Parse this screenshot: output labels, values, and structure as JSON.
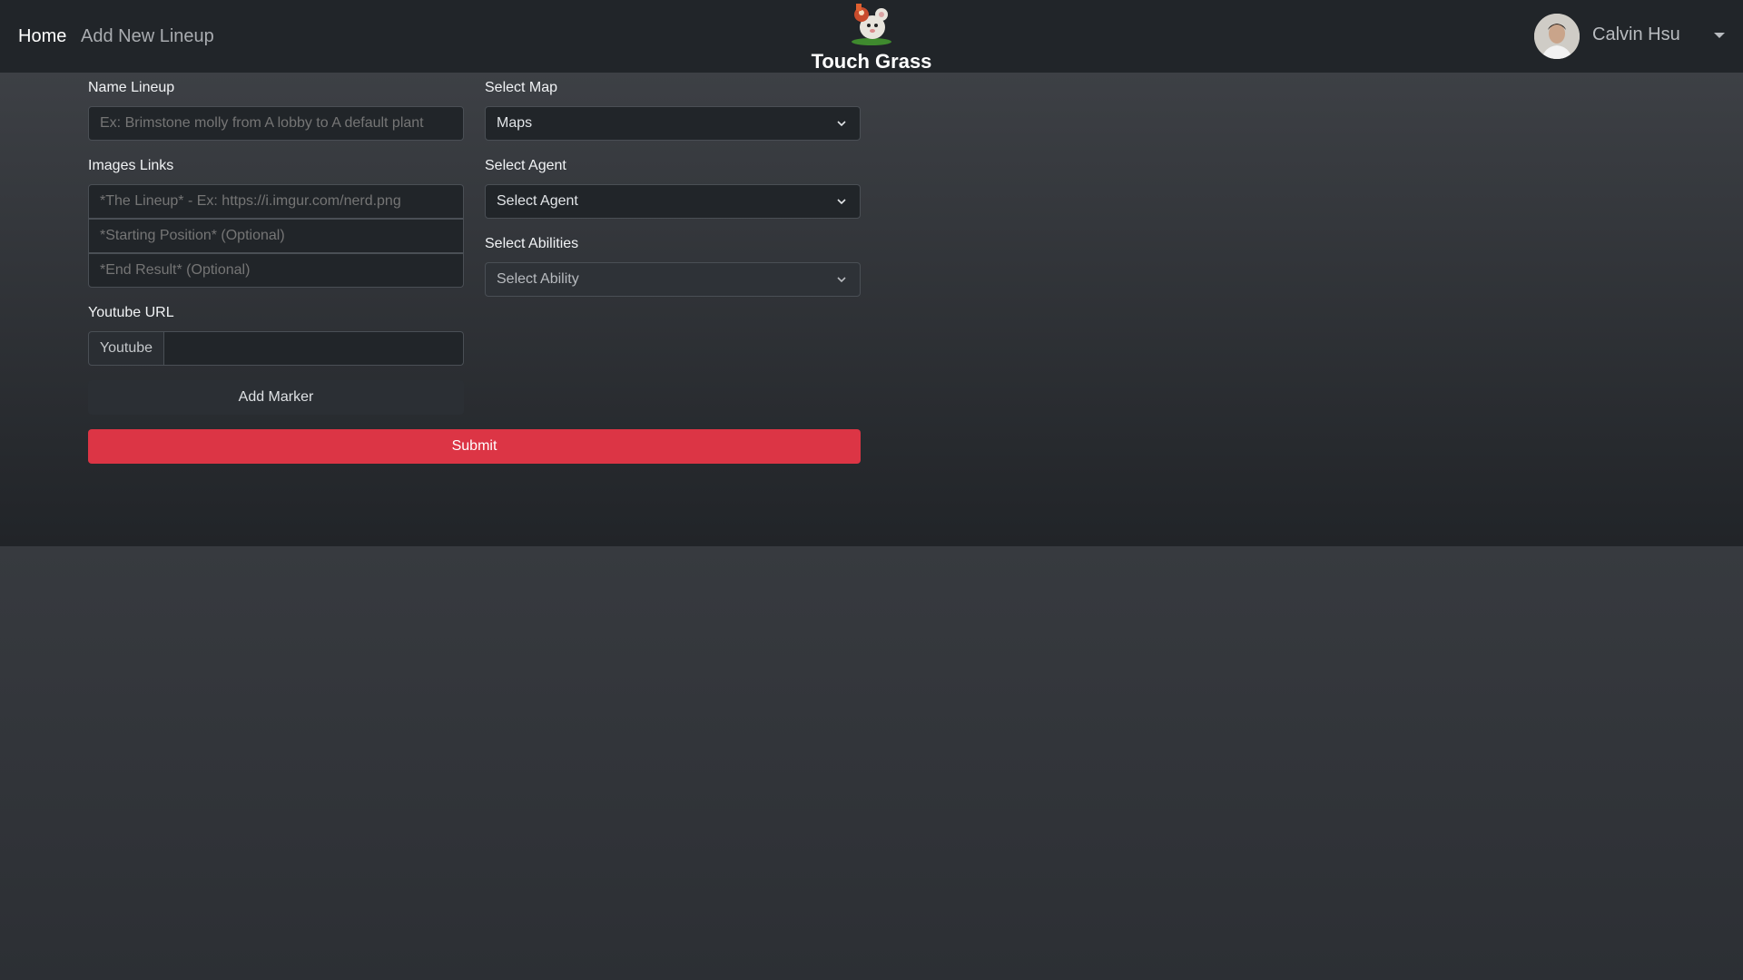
{
  "nav": {
    "home": "Home",
    "add_new_lineup": "Add New Lineup",
    "brand": "Touch Grass",
    "user_name": "Calvin Hsu"
  },
  "form": {
    "name_lineup": {
      "label": "Name Lineup",
      "placeholder": "Ex: Brimstone molly from A lobby to A default plant"
    },
    "images": {
      "label": "Images Links",
      "lineup_placeholder": "*The Lineup* - Ex: https://i.imgur.com/nerd.png",
      "start_placeholder": "*Starting Position* (Optional)",
      "end_placeholder": "*End Result* (Optional)"
    },
    "youtube": {
      "label": "Youtube URL",
      "addon": "Youtube",
      "value": ""
    },
    "map": {
      "label": "Select Map",
      "selected": "Maps"
    },
    "agent": {
      "label": "Select Agent",
      "selected": "Select Agent"
    },
    "abilities": {
      "label": "Select Abilities",
      "selected": "Select Ability"
    },
    "add_marker": "Add Marker",
    "submit": "Submit"
  },
  "colors": {
    "navbar": "#212529",
    "submit": "#dc3545",
    "input_bg": "#212529"
  },
  "icons": {
    "chevron": "chevron-down-icon",
    "caret": "caret-down-icon"
  }
}
